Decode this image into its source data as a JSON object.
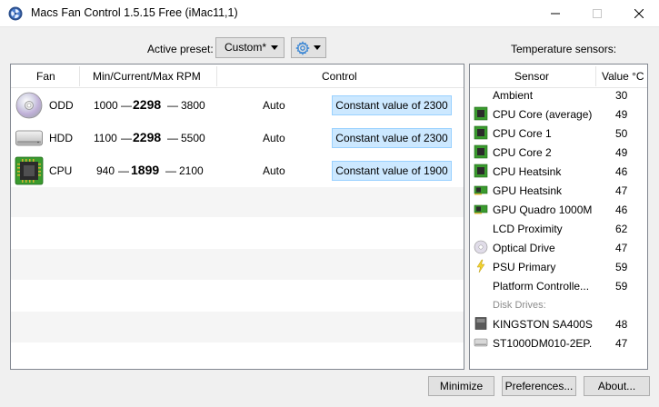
{
  "window": {
    "title": "Macs Fan Control 1.5.15 Free (iMac11,1)"
  },
  "preset": {
    "label": "Active preset:",
    "value": "Custom*"
  },
  "temperature_label": "Temperature sensors:",
  "fan_table": {
    "headers": {
      "fan": "Fan",
      "rpm": "Min/Current/Max RPM",
      "control": "Control"
    },
    "rows": [
      {
        "icon": "optical-drive-icon",
        "name": "ODD",
        "min": "1000",
        "current": "2298",
        "max": "3800",
        "mode": "Auto",
        "control": "Constant value of 2300"
      },
      {
        "icon": "hard-drive-icon",
        "name": "HDD",
        "min": "1100",
        "current": "2298",
        "max": "5500",
        "mode": "Auto",
        "control": "Constant value of 2300"
      },
      {
        "icon": "cpu-chip-icon",
        "name": "CPU",
        "min": "940",
        "current": "1899",
        "max": "2100",
        "mode": "Auto",
        "control": "Constant value of 1900"
      }
    ]
  },
  "sensor_table": {
    "headers": {
      "sensor": "Sensor",
      "value": "Value °C"
    },
    "rows": [
      {
        "icon": "none",
        "name": "Ambient",
        "value": "30"
      },
      {
        "icon": "chip-icon",
        "name": "CPU Core (average)",
        "value": "49"
      },
      {
        "icon": "chip-icon",
        "name": "CPU Core 1",
        "value": "50"
      },
      {
        "icon": "chip-icon",
        "name": "CPU Core 2",
        "value": "49"
      },
      {
        "icon": "chip-icon",
        "name": "CPU Heatsink",
        "value": "46"
      },
      {
        "icon": "gpu-card-icon",
        "name": "GPU Heatsink",
        "value": "47"
      },
      {
        "icon": "gpu-card-icon",
        "name": "GPU Quadro 1000M",
        "value": "46"
      },
      {
        "icon": "none",
        "name": "LCD Proximity",
        "value": "62"
      },
      {
        "icon": "optical-drive-icon",
        "name": "Optical Drive",
        "value": "47"
      },
      {
        "icon": "lightning-icon",
        "name": "PSU Primary",
        "value": "59"
      },
      {
        "icon": "none",
        "name": "Platform Controlle...",
        "value": "59"
      }
    ],
    "disk_group": "Disk Drives:",
    "disk_rows": [
      {
        "icon": "ssd-icon",
        "name": "KINGSTON SA400S...",
        "value": "48"
      },
      {
        "icon": "hard-drive-icon",
        "name": "ST1000DM010-2EP...",
        "value": "47"
      }
    ]
  },
  "buttons": {
    "minimize": "Minimize",
    "preferences": "Preferences...",
    "about": "About..."
  },
  "colors": {
    "selection_fill": "#cce8ff",
    "selection_border": "#99d1ff",
    "chip_green": "#3a9a2e"
  }
}
